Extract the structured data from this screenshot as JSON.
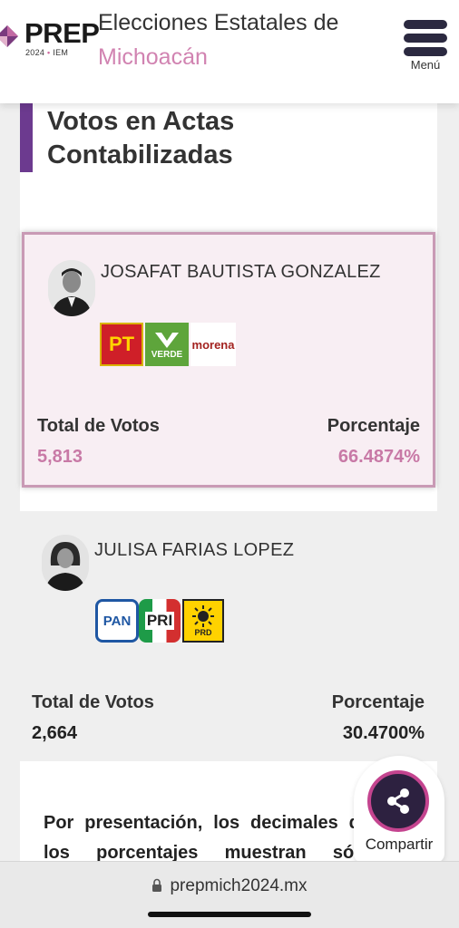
{
  "header": {
    "logo_text": "PREP",
    "logo_year": "2024",
    "logo_sep": "•",
    "logo_org": "IEM",
    "title_line1": "Elecciones Estatales de",
    "title_line2": "Michoacán",
    "menu_label": "Menú"
  },
  "section": {
    "title": "Votos en Actas Contabilizadas"
  },
  "candidates": [
    {
      "name": "JOSAFAT BAUTISTA GONZALEZ",
      "parties": [
        "PT",
        "VERDE",
        "morena"
      ],
      "votes_label": "Total de Votos",
      "votes": "5,813",
      "pct_label": "Porcentaje",
      "pct": "66.4874%"
    },
    {
      "name": "JULISA FARIAS LOPEZ",
      "parties": [
        "PAN",
        "PRI",
        "PRD"
      ],
      "votes_label": "Total de Votos",
      "votes": "2,664",
      "pct_label": "Porcentaje",
      "pct": "30.4700%"
    }
  ],
  "note": {
    "text": "Por presentación, los decimales de los porcentajes muestran sólo"
  },
  "share": {
    "label": "Compartir"
  },
  "browser": {
    "url": "prepmich2024.mx"
  },
  "colors": {
    "accent_purple": "#6c3a8f",
    "highlight_pink": "#d183b1",
    "value_pink": "#c879a6",
    "share_border": "#c4448f"
  }
}
